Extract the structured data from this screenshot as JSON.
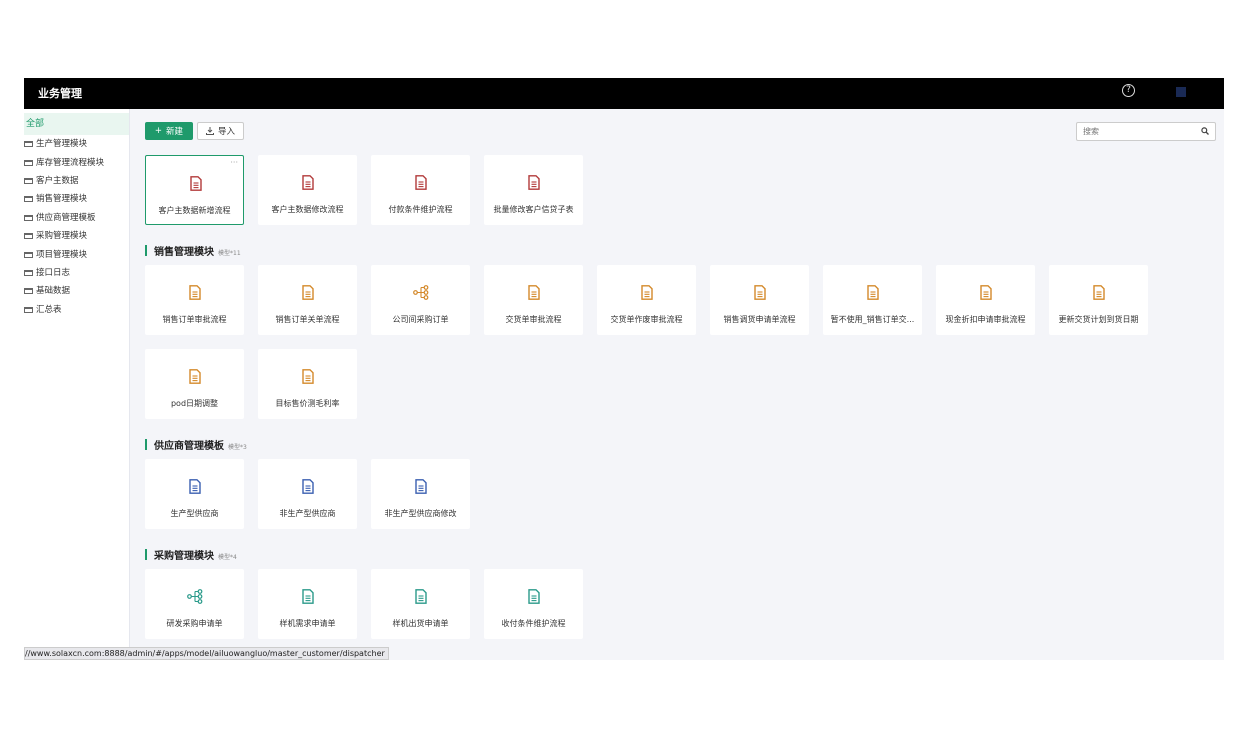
{
  "app": {
    "title": "业务管理"
  },
  "header": {
    "help_glyph": "?"
  },
  "sidebar": {
    "all_label": "全部",
    "items": [
      "生产管理模块",
      "库存管理流程模块",
      "客户主数据",
      "销售管理模块",
      "供应商管理模板",
      "采购管理模块",
      "项目管理模块",
      "接口日志",
      "基础数据",
      "汇总表"
    ]
  },
  "toolbar": {
    "new_label": "新建",
    "new_glyph": "+",
    "import_label": "导入"
  },
  "search": {
    "placeholder": "搜索"
  },
  "icons": {
    "doc_colors": {
      "red": "#b23a3a",
      "orange": "#d4892a",
      "blue": "#3a5fb0",
      "teal": "#2a9a8a"
    }
  },
  "top_cards": [
    {
      "label": "客户主数据新增流程",
      "icon": "document-icon",
      "color": "red",
      "more": "···"
    },
    {
      "label": "客户主数据修改流程",
      "icon": "document-icon",
      "color": "red"
    },
    {
      "label": "付款条件维护流程",
      "icon": "document-icon",
      "color": "red"
    },
    {
      "label": "批量修改客户信贷子表",
      "icon": "document-icon",
      "color": "red"
    }
  ],
  "sections": [
    {
      "title": "销售管理模块",
      "count": "模型*11",
      "cards": [
        {
          "label": "销售订单审批流程",
          "icon": "document-icon",
          "color": "orange"
        },
        {
          "label": "销售订单关单流程",
          "icon": "document-icon",
          "color": "orange"
        },
        {
          "label": "公司间采购订单",
          "icon": "flow-icon",
          "color": "orange"
        },
        {
          "label": "交货单审批流程",
          "icon": "document-icon",
          "color": "orange"
        },
        {
          "label": "交货单作废审批流程",
          "icon": "document-icon",
          "color": "orange"
        },
        {
          "label": "销售调货申请单流程",
          "icon": "document-icon",
          "color": "orange"
        },
        {
          "label": "暂不使用_销售订单交...",
          "icon": "document-icon",
          "color": "orange"
        },
        {
          "label": "现金折扣申请审批流程",
          "icon": "document-icon",
          "color": "orange"
        },
        {
          "label": "更新交货计划到货日期",
          "icon": "document-icon",
          "color": "orange"
        },
        {
          "label": "pod日期调整",
          "icon": "document-icon",
          "color": "orange"
        },
        {
          "label": "目标售价测毛利率",
          "icon": "document-icon",
          "color": "orange"
        }
      ]
    },
    {
      "title": "供应商管理模板",
      "count": "模型*3",
      "cards": [
        {
          "label": "生产型供应商",
          "icon": "document-icon",
          "color": "blue"
        },
        {
          "label": "非生产型供应商",
          "icon": "document-icon",
          "color": "blue"
        },
        {
          "label": "非生产型供应商修改",
          "icon": "document-icon",
          "color": "blue"
        }
      ]
    },
    {
      "title": "采购管理模块",
      "count": "模型*4",
      "cards": [
        {
          "label": "研发采购申请单",
          "icon": "flow-icon",
          "color": "teal"
        },
        {
          "label": "样机需求申请单",
          "icon": "document-icon",
          "color": "teal"
        },
        {
          "label": "样机出货申请单",
          "icon": "document-icon",
          "color": "teal"
        },
        {
          "label": "收付条件维护流程",
          "icon": "document-icon",
          "color": "teal"
        }
      ]
    }
  ],
  "status_bar": {
    "url": "//www.solaxcn.com:8888/admin/#/apps/model/ailuowangluo/master_customer/dispatcher"
  }
}
